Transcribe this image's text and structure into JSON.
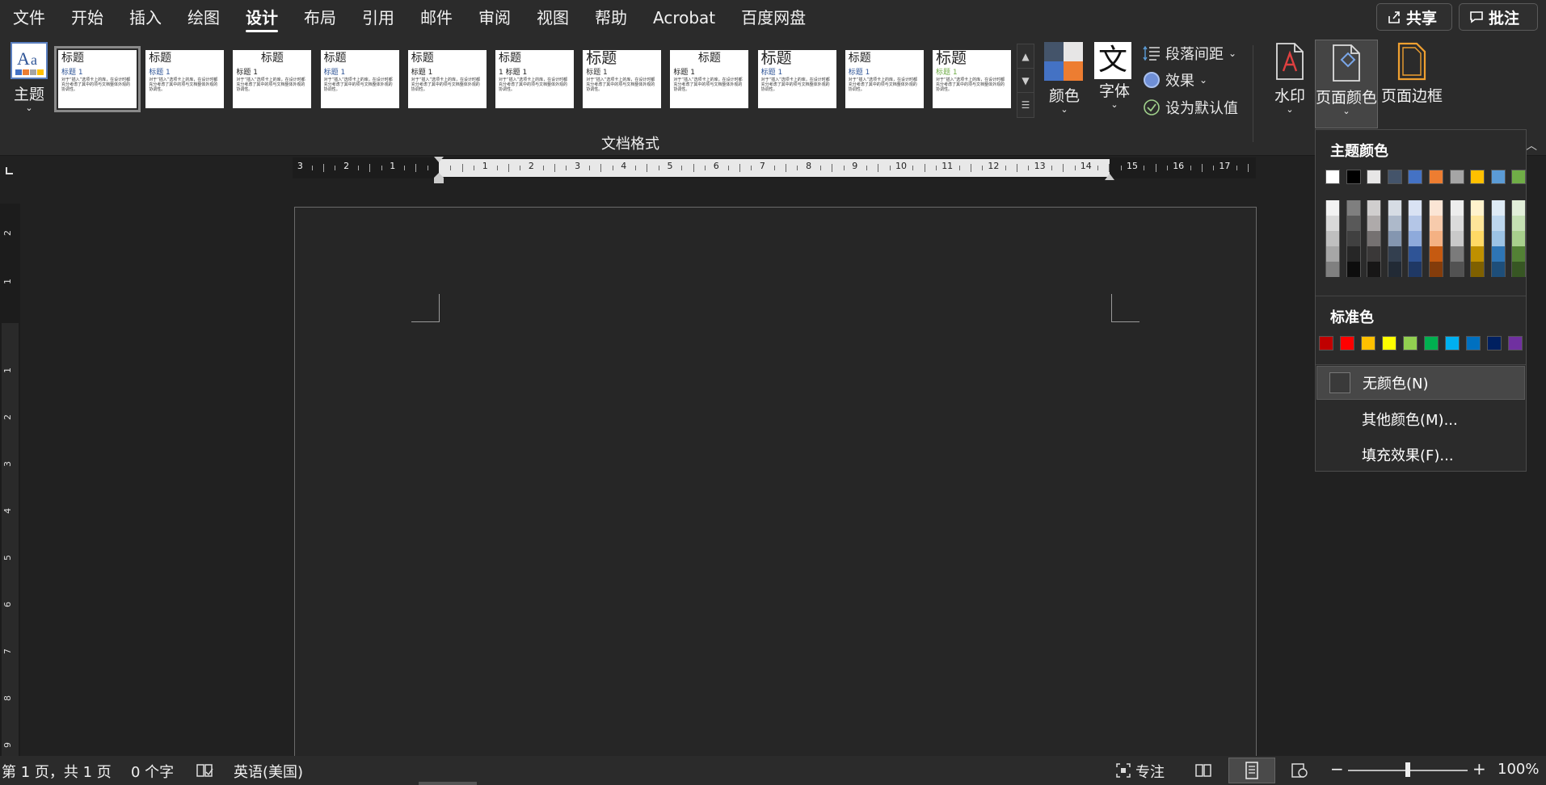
{
  "menu": {
    "tabs": [
      "文件",
      "开始",
      "插入",
      "绘图",
      "设计",
      "布局",
      "引用",
      "邮件",
      "审阅",
      "视图",
      "帮助",
      "Acrobat",
      "百度网盘"
    ],
    "active_index": 4,
    "share_label": "共享",
    "comments_label": "批注"
  },
  "ribbon": {
    "theme_label": "主题",
    "style_gallery": [
      {
        "title": "标题",
        "heading": "标题 1",
        "body": "对于“插入”选项卡上的库，在设计时都充分考虑了其中的项与文档整体外观的协调性。"
      },
      {
        "title": "标题",
        "heading": "标题 1",
        "body": "对于“插入”选项卡上的库，在设计时都充分考虑了其中的项与文档整体外观的协调性。"
      },
      {
        "title": "标题",
        "heading": "标题 1",
        "body": "对于“插入”选项卡上的库，在设计时都充分考虑了其中的项与文档整体外观的协调性。"
      },
      {
        "title": "标题",
        "heading": "标题 1",
        "body": "对于“插入”选项卡上的库，在设计时都充分考虑了其中的项与文档整体外观的协调性。"
      },
      {
        "title": "标题",
        "heading": "标题 1",
        "body": "对于“插入”选项卡上的库，在设计时都充分考虑了其中的项与文档整体外观的协调性。"
      },
      {
        "title": "标题",
        "heading": "1  标题 1",
        "body": "对于“插入”选项卡上的库，在设计时都充分考虑了其中的项与文档整体外观的协调性。"
      },
      {
        "title": "标题",
        "heading": "标题 1",
        "body": "对于“插入”选项卡上的库，在设计时都充分考虑了其中的项与文档整体外观的协调性。"
      },
      {
        "title": "标题",
        "heading": "标题 1",
        "body": "对于“插入”选项卡上的库，在设计时都充分考虑了其中的项与文档整体外观的协调性。"
      },
      {
        "title": "标题",
        "heading": "标题 1",
        "body": "对于“插入”选项卡上的库，在设计时都充分考虑了其中的项与文档整体外观的协调性。"
      },
      {
        "title": "标题",
        "heading": "标题 1",
        "body": "对于“插入”选项卡上的库，在设计时都充分考虑了其中的项与文档整体外观的协调性。"
      },
      {
        "title": "标题",
        "heading": "标题 1",
        "body": "对于“插入”选项卡上的库，在设计时都充分考虑了其中的项与文档整体外观的协调性。"
      }
    ],
    "group_label": "文档格式",
    "colors_label": "颜色",
    "fonts_label": "字体",
    "fonts_glyph": "文",
    "paragraph_spacing_label": "段落间距",
    "effects_label": "效果",
    "set_default_label": "设为默认值",
    "watermark_label": "水印",
    "page_color_label": "页面颜色",
    "page_borders_label": "页面边框"
  },
  "ruler": {
    "ticks_left": [
      "3",
      "2",
      "1"
    ],
    "ticks_right": [
      "1",
      "2",
      "3",
      "4",
      "5",
      "6",
      "7",
      "8",
      "9",
      "10",
      "11",
      "12",
      "13",
      "14",
      "15",
      "16",
      "17"
    ],
    "vertical_ticks": [
      "2",
      "1",
      "1",
      "2",
      "3",
      "4",
      "5",
      "6",
      "7",
      "8",
      "9"
    ]
  },
  "dropdown": {
    "theme_colors_heading": "主题颜色",
    "theme_top_row": [
      "#ffffff",
      "#000000",
      "#e7e6e6",
      "#44546a",
      "#4472c4",
      "#ed7d31",
      "#a5a5a5",
      "#ffc000",
      "#5b9bd5",
      "#70ad47"
    ],
    "theme_shades": [
      [
        "#f2f2f2",
        "#d9d9d9",
        "#bfbfbf",
        "#a6a6a6",
        "#808080"
      ],
      [
        "#7f7f7f",
        "#595959",
        "#404040",
        "#262626",
        "#0d0d0d"
      ],
      [
        "#d0cece",
        "#aeaaaa",
        "#757171",
        "#3a3838",
        "#171616"
      ],
      [
        "#d6dce4",
        "#adb9ca",
        "#8496b0",
        "#333f4f",
        "#222a35"
      ],
      [
        "#d9e2f3",
        "#b4c6e7",
        "#8eaadb",
        "#2f5496",
        "#1f3864"
      ],
      [
        "#fbe5d5",
        "#f7cbac",
        "#f4b183",
        "#c55a11",
        "#833c0b"
      ],
      [
        "#ededed",
        "#dbdbdb",
        "#c9c9c9",
        "#7b7b7b",
        "#525252"
      ],
      [
        "#fff2cc",
        "#fee599",
        "#ffd965",
        "#bf9000",
        "#7f6000"
      ],
      [
        "#deebf6",
        "#bdd7ee",
        "#9cc3e5",
        "#2e75b5",
        "#1e4e79"
      ],
      [
        "#e2efd9",
        "#c5e0b3",
        "#a8d08d",
        "#538135",
        "#375623"
      ]
    ],
    "standard_colors_heading": "标准色",
    "standard_colors": [
      "#c00000",
      "#ff0000",
      "#ffc000",
      "#ffff00",
      "#92d050",
      "#00b050",
      "#00b0f0",
      "#0070c0",
      "#002060",
      "#7030a0"
    ],
    "no_color_label": "无颜色(N)",
    "more_colors_label": "其他颜色(M)...",
    "fill_effects_label": "填充效果(F)..."
  },
  "status": {
    "page_info": "第 1 页，共 1 页",
    "word_count": "0 个字",
    "language": "英语(美国)",
    "focus_label": "专注",
    "zoom": "100%",
    "zoom_fraction": 0.5
  }
}
